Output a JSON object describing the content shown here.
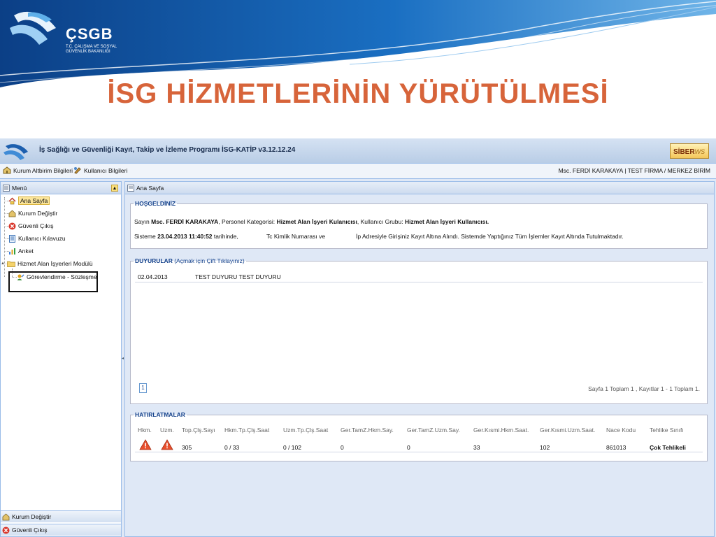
{
  "slide": {
    "logo_text": "ÇSGB",
    "logo_sub": "T.C. ÇALIŞMA VE SOSYAL GÜVENLİK BAKANLIĞI",
    "title": "İSG HİZMETLERİNİN YÜRÜTÜLMESİ",
    "title_color": "#d7643a"
  },
  "app": {
    "title": "İş Sağlığı ve Güvenliği Kayıt, Takip ve İzleme Programı İSG-KATİP v3.12.12.24",
    "vendor_logo": "SİBER",
    "vendor_logo_script": "ws",
    "toolbar": {
      "item1": "Kurum Altbirim Bilgileri",
      "item2": "Kullanıcı Bilgileri",
      "user": "Msc. FERDİ KARAKAYA | TEST FİRMA / MERKEZ BİRİM"
    }
  },
  "menu": {
    "title": "Menü",
    "items": [
      {
        "label": "Ana Sayfa",
        "icon": "home-icon"
      },
      {
        "label": "Kurum Değiştir",
        "icon": "org-icon"
      },
      {
        "label": "Güvenli Çıkış",
        "icon": "exit-icon"
      },
      {
        "label": "Kullanıcı Kılavuzu",
        "icon": "doc-icon"
      },
      {
        "label": "Anket",
        "icon": "chart-icon"
      },
      {
        "label": "Hizmet Alan İşyerleri Modülü",
        "icon": "folder-icon"
      },
      {
        "label": "Görevlendirme - Sözleşme",
        "icon": "assign-icon"
      }
    ],
    "footer": [
      "Kurum Değiştir",
      "Güvenli Çıkış"
    ]
  },
  "main": {
    "tab": "Ana Sayfa",
    "welcome": {
      "legend": "HOŞGELDİNİZ",
      "l1_a": "Sayın ",
      "l1_name": "Msc. FERDİ KARAKAYA",
      "l1_b": ", Personel Kategorisi: ",
      "l1_cat": "Hizmet Alan İşyeri Kulanıcısı",
      "l1_c": ", Kullanıcı Grubu: ",
      "l1_group": "Hizmet Alan İşyeri Kullanıcısı.",
      "l2_a": "Sisteme ",
      "l2_date": "23.04.2013 11:40:52",
      "l2_b": " tarihinde,",
      "l2_c": "Tc Kimlik Numarası ve",
      "l2_d": "İp Adresiyle Girişiniz Kayıt Altına Alındı. Sistemde Yaptığınız Tüm İşlemler Kayıt Altında Tutulmaktadır."
    },
    "announcements": {
      "legend": "DUYURULAR",
      "hint": " (Açmak için Çift Tıklayınız)",
      "rows": [
        {
          "date": "02.04.2013",
          "text": "TEST DUYURU TEST DUYURU"
        }
      ],
      "page": "1",
      "pager": "Sayfa 1 Toplam 1 , Kayıtlar 1 - 1 Toplam 1."
    },
    "reminders": {
      "legend": "HATIRLATMALAR",
      "headers": [
        "Hkm.",
        "Uzm.",
        "Top.Çlş.Sayı",
        "Hkm.Tp.Çlş.Saat",
        "Uzm.Tp.Çlş.Saat",
        "Ger.TamZ.Hkm.Say.",
        "Ger.TamZ.Uzm.Say.",
        "Ger.Kısmi.Hkm.Saat.",
        "Ger.Kısmi.Uzm.Saat.",
        "Nace Kodu",
        "Tehlike Sınıfı"
      ],
      "values": [
        "305",
        "0 / 33",
        "0 / 102",
        "0",
        "0",
        "33",
        "102",
        "861013",
        "Çok Tehlikeli"
      ]
    }
  }
}
